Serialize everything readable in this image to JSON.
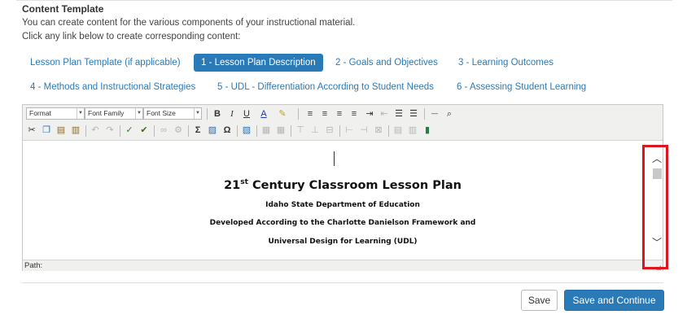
{
  "header": {
    "title": "Content Template",
    "line1": "You can create content for the various components of your instructional material.",
    "line2": "Click any link below to create corresponding content:"
  },
  "tabs": [
    {
      "label": "Lesson Plan Template (if applicable)",
      "active": false
    },
    {
      "label": "1 - Lesson Plan Description",
      "active": true
    },
    {
      "label": "2 - Goals and Objectives",
      "active": false
    },
    {
      "label": "3 - Learning Outcomes",
      "active": false
    },
    {
      "label": "4 - Methods and Instructional Strategies",
      "active": false
    },
    {
      "label": "5 - UDL - Differentiation According to Student Needs",
      "active": false
    },
    {
      "label": "6 - Assessing Student Learning",
      "active": false
    }
  ],
  "toolbar": {
    "format_label": "Format",
    "font_family_label": "Font Family",
    "font_size_label": "Font Size"
  },
  "document": {
    "title_prefix": "21",
    "title_sup": "st",
    "title_rest": " Century Classroom Lesson Plan",
    "line1": "Idaho State Department of Education",
    "line2": "Developed According to the Charlotte Danielson Framework and",
    "line3": "Universal Design for Learning (UDL)"
  },
  "status": {
    "path_label": "Path:"
  },
  "actions": {
    "save": "Save",
    "save_continue": "Save and Continue"
  },
  "colors": {
    "accent": "#2a7ab8",
    "highlight": "#e0141e"
  }
}
